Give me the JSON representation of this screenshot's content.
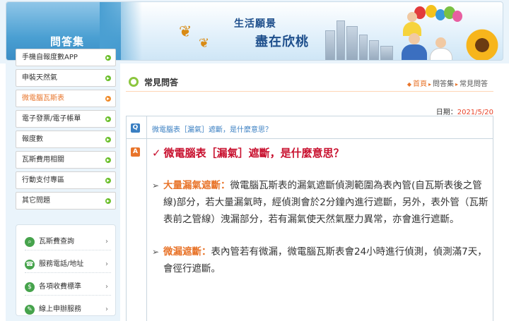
{
  "banner": {
    "qa_heading": "問答集",
    "slogan_line1": "生活願景",
    "slogan_line2": "盡在欣桃"
  },
  "sidebar": {
    "menu": [
      {
        "label": "手機自報度數APP",
        "active": false
      },
      {
        "label": "申裝天然氣",
        "active": false
      },
      {
        "label": "微電腦瓦斯表",
        "active": true
      },
      {
        "label": "電子發票/電子帳單",
        "active": false
      },
      {
        "label": "報度數",
        "active": false
      },
      {
        "label": "瓦斯費用相關",
        "active": false
      },
      {
        "label": "行動支付專區",
        "active": false
      },
      {
        "label": "其它問題",
        "active": false
      }
    ],
    "services": [
      {
        "label": "瓦斯費查詢",
        "icon": "search-icon",
        "arrow": "›"
      },
      {
        "label": "服務電話/地址",
        "icon": "phone-icon",
        "arrow": "›"
      },
      {
        "label": "各項收費標準",
        "icon": "dollar-icon",
        "arrow": "›"
      },
      {
        "label": "線上申辦服務",
        "icon": "form-icon",
        "arrow": "›"
      }
    ]
  },
  "main": {
    "title": "常見問答",
    "breadcrumb": {
      "home": "首頁",
      "level1": "問答集",
      "level2": "常見問答"
    },
    "date_label": "日期：",
    "date_value": "2021/5/20",
    "question_badge": "Q",
    "answer_badge": "A",
    "question": "微電腦表［漏氣］遮斷，是什麼意思？",
    "answer_title": "微電腦表［漏氣］遮斷，是什麼意思？",
    "paragraphs": [
      {
        "highlight": "大量漏氣遮斷：",
        "text": "微電腦瓦斯表的漏氣遮斷偵測範圍為表內管(自瓦斯表後之管線)部分，若大量漏氣時，經偵測會於2分鐘內進行遮斷，另外，表外管（瓦斯表前之管線）洩漏部分，若有漏氣使天然氣壓力異常，亦會進行遮斷。"
      },
      {
        "highlight": "微漏遮斷：",
        "text": "表內管若有微漏，微電腦瓦斯表會24小時進行偵測，偵測滿7天，會徑行遮斷。"
      }
    ]
  },
  "colors": {
    "accent_orange": "#e8742a",
    "answer_red": "#c8102e",
    "question_blue": "#3a7fc2",
    "menu_green": "#6cbf2c"
  }
}
